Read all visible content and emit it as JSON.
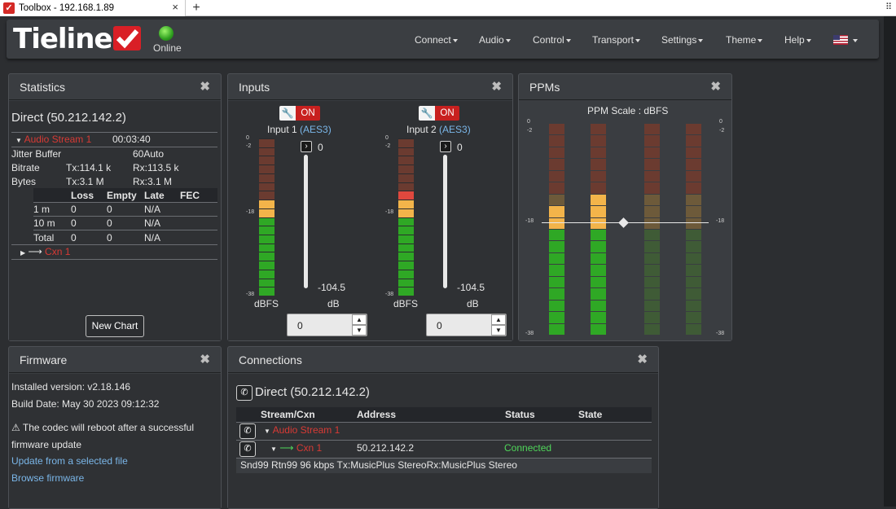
{
  "browser": {
    "tab_title": "Toolbox - 192.168.1.89",
    "new_tab": "+",
    "close": "×"
  },
  "brand": {
    "logo": "Tieline",
    "status": "Online"
  },
  "menu": [
    "Connect",
    "Audio",
    "Control",
    "Transport",
    "Settings",
    "Theme",
    "Help"
  ],
  "statistics": {
    "title": "Statistics",
    "conn": "Direct (50.212.142.2)",
    "stream": "Audio Stream 1",
    "duration": "00:03:40",
    "jitter_label": "Jitter Buffer",
    "jitter_value": "60Auto",
    "bitrate_label": "Bitrate",
    "bitrate_tx": "Tx:114.1 k",
    "bitrate_rx": "Rx:113.5 k",
    "bytes_label": "Bytes",
    "bytes_tx": "Tx:3.1 M",
    "bytes_rx": "Rx:3.1 M",
    "headers": [
      "Loss",
      "Empty",
      "Late",
      "FEC"
    ],
    "rows": [
      {
        "label": "1 m",
        "loss": "0",
        "empty": "0",
        "late": "N/A"
      },
      {
        "label": "10 m",
        "loss": "0",
        "empty": "0",
        "late": "N/A"
      },
      {
        "label": "Total",
        "loss": "0",
        "empty": "0",
        "late": "N/A"
      }
    ],
    "cxn": "Cxn 1",
    "new_chart": "New Chart"
  },
  "inputs": {
    "title": "Inputs",
    "ticks": [
      "0",
      "-2",
      "-18",
      "-38"
    ],
    "channels": [
      {
        "on": "ON",
        "name": "Input 1",
        "type": "(AES3)",
        "fader_top": "0",
        "fader_bottom": "-104.5",
        "unit_left": "dBFS",
        "unit_right": "dB",
        "value": "0",
        "level": 0.62
      },
      {
        "on": "ON",
        "name": "Input 2",
        "type": "(AES3)",
        "fader_top": "0",
        "fader_bottom": "-104.5",
        "unit_left": "dBFS",
        "unit_right": "dB",
        "value": "0",
        "level": 0.65
      }
    ]
  },
  "ppms": {
    "title": "PPMs",
    "scale": "PPM Scale : dBFS",
    "ticks": [
      "0",
      "-2",
      "-18",
      "-38"
    ],
    "levels": [
      0.63,
      0.66,
      0,
      0
    ]
  },
  "firmware": {
    "title": "Firmware",
    "installed": "Installed version: v2.18.146",
    "build": "Build Date: May 30 2023 09:12:32",
    "warning_line1": "The codec will reboot after a successful",
    "warning_line2": "firmware update",
    "update_link": "Update from a selected file",
    "browse_link": "Browse firmware"
  },
  "connections": {
    "title": "Connections",
    "conn": "Direct (50.212.142.2)",
    "headers": {
      "stream": "Stream/Cxn",
      "address": "Address",
      "status": "Status",
      "state": "State"
    },
    "stream": "Audio Stream 1",
    "cxn": "Cxn 1",
    "address": "50.212.142.2",
    "status": "Connected",
    "detail": "Snd99 Rtn99 96 kbps Tx:MusicPlus StereoRx:MusicPlus Stereo"
  },
  "colors": {
    "accent_red": "#d83a34",
    "link_blue": "#7ab6e8",
    "connected_green": "#4fd65a",
    "meter_green": "#2fa825",
    "meter_amber": "#f3b44a"
  }
}
